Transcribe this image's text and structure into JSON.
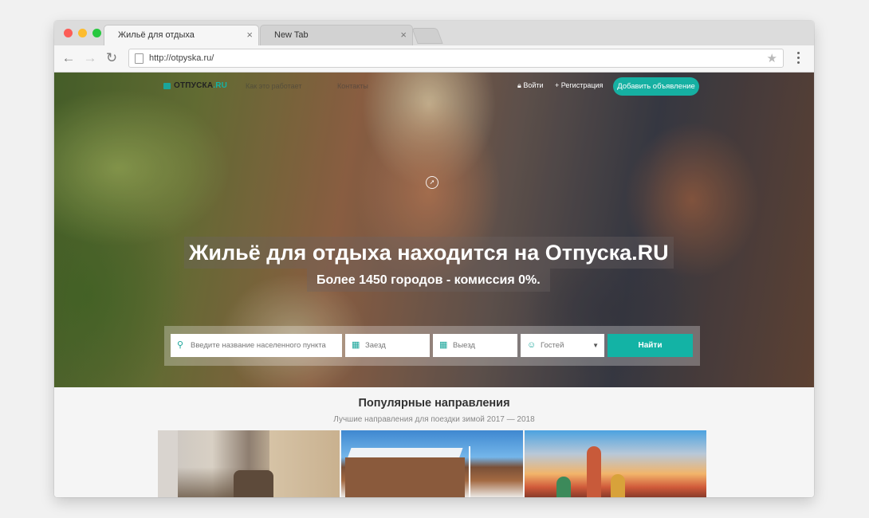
{
  "browser": {
    "tabs": [
      {
        "title": "Жильё для отдыха",
        "active": true
      },
      {
        "title": "New Tab",
        "active": false
      }
    ],
    "close_glyph": "×",
    "url": "http://otpyska.ru/",
    "nav": {
      "back": "←",
      "forward": "→",
      "reload": "↻",
      "star": "★"
    }
  },
  "site": {
    "logo": {
      "name": "ОТПУСКА",
      "tld": ".RU"
    },
    "nav_links": [
      "Как это работает",
      "Контакты"
    ],
    "login_label": "Войти",
    "register_label": "Регистрация",
    "add_listing_label": "Добавить объявление",
    "hero": {
      "title": "Жильё для отдыха находится на Отпуска.RU",
      "subtitle": "Более 1450 городов - комиссия 0%."
    },
    "search": {
      "location_placeholder": "Введите название населенного пункта",
      "checkin_placeholder": "Заезд",
      "checkout_placeholder": "Выезд",
      "guests_label": "Гостей",
      "find_label": "Найти"
    },
    "popular": {
      "title": "Популярные направления",
      "subtitle": "Лучшие направления для поездки зимой 2017 — 2018"
    }
  },
  "colors": {
    "accent": "#14b3a5",
    "accent_dark": "#1aa59a"
  },
  "icons": {
    "login": "lock-icon",
    "register": "plus-icon",
    "location": "map-pin-icon",
    "calendar": "calendar-icon",
    "guests": "user-icon",
    "compass": "compass-icon"
  }
}
